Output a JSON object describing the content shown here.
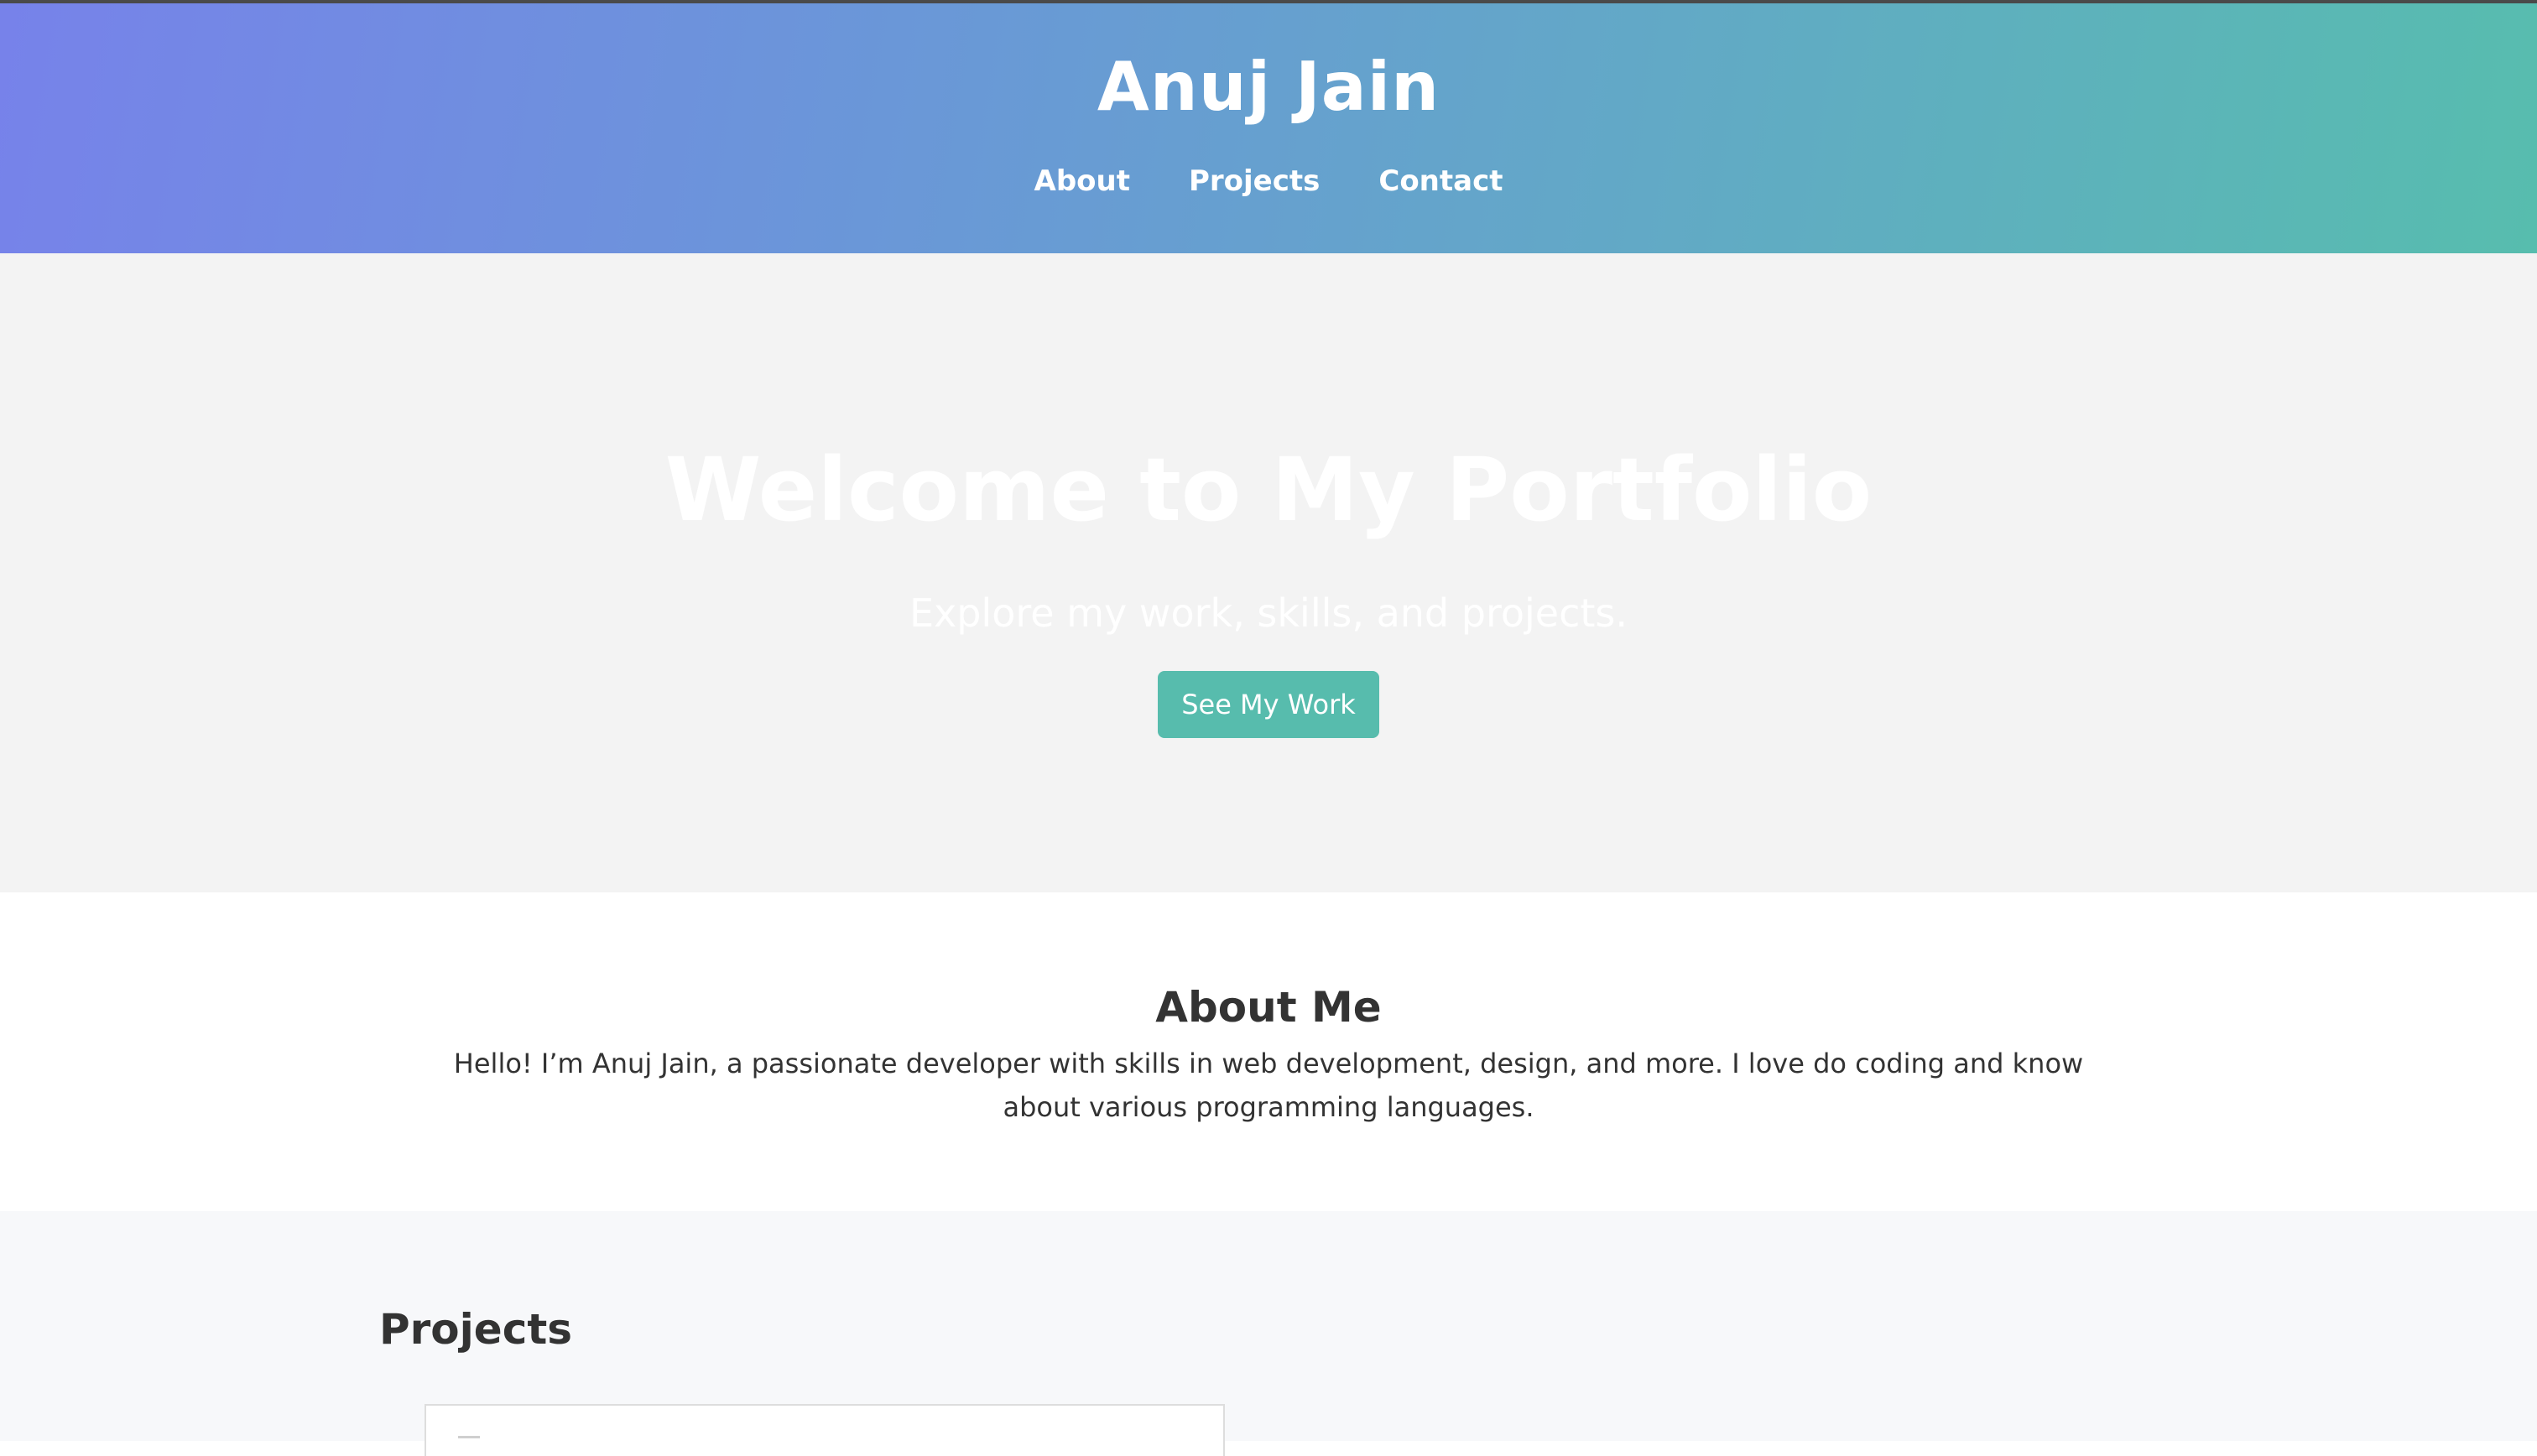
{
  "header": {
    "title": "Anuj Jain",
    "nav": [
      {
        "label": "About"
      },
      {
        "label": "Projects"
      },
      {
        "label": "Contact"
      }
    ]
  },
  "hero": {
    "title": "Welcome to My Portfolio",
    "subtitle": "Explore my work, skills, and projects.",
    "cta_label": "See My Work"
  },
  "about": {
    "title": "About Me",
    "text": "Hello! I’m Anuj Jain, a passionate developer with skills in web development, design, and more. I love do coding and know about various programming languages."
  },
  "projects": {
    "title": "Projects"
  },
  "colors": {
    "accent": "#57bcad",
    "header_gradient_start": "#7782ea",
    "header_gradient_end": "#57bdae",
    "hero_bg": "#f3f3f3",
    "text": "#333333"
  }
}
